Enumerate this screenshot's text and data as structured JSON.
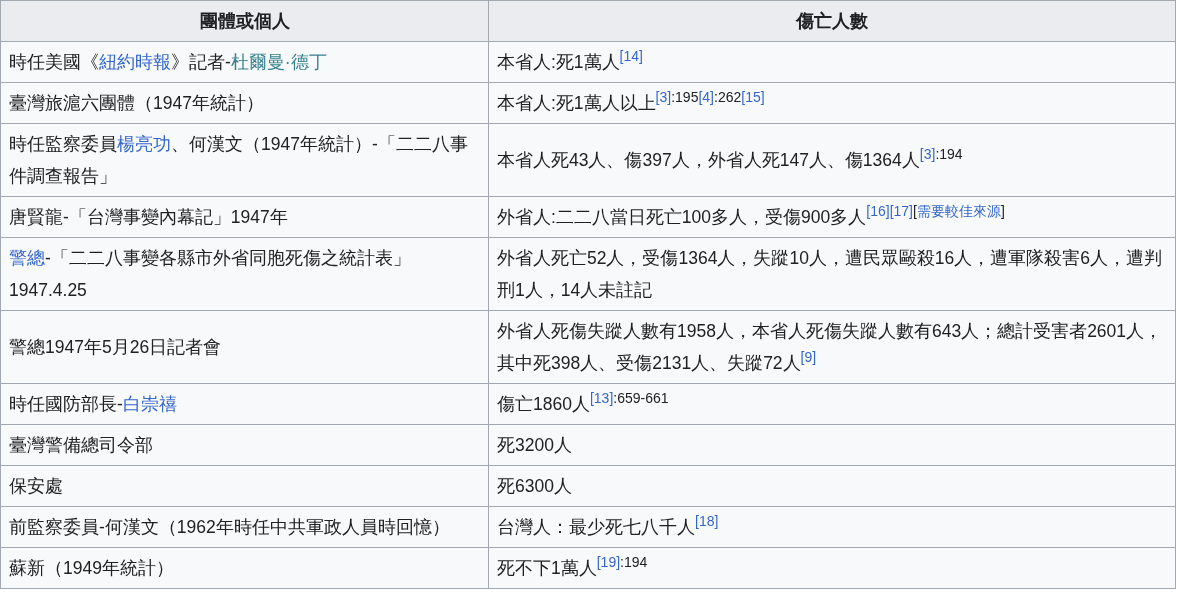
{
  "table": {
    "columns": [
      "團體或個人",
      "傷亡人數"
    ],
    "rows": [
      [
        [
          {
            "kind": "text",
            "text": "時任美國《"
          },
          {
            "kind": "link",
            "text": "紐約時報"
          },
          {
            "kind": "text",
            "text": "》記者-"
          },
          {
            "kind": "ext-link",
            "text": "杜爾曼·德丁"
          }
        ],
        [
          {
            "kind": "text",
            "text": "本省人:死1萬人"
          },
          {
            "kind": "ref",
            "text": "[14]"
          }
        ]
      ],
      [
        [
          {
            "kind": "text",
            "text": "臺灣旅滬六團體（1947年統計）"
          }
        ],
        [
          {
            "kind": "text",
            "text": "本省人:死1萬人以上"
          },
          {
            "kind": "ref",
            "text": "[3]"
          },
          {
            "kind": "sup",
            "text": ":195"
          },
          {
            "kind": "ref",
            "text": "[4]"
          },
          {
            "kind": "sup",
            "text": ":262"
          },
          {
            "kind": "ref",
            "text": "[15]"
          }
        ]
      ],
      [
        [
          {
            "kind": "text",
            "text": "時任監察委員"
          },
          {
            "kind": "link",
            "text": "楊亮功"
          },
          {
            "kind": "text",
            "text": "、何漢文（1947年統計）-「二二八事件調查報告」"
          }
        ],
        [
          {
            "kind": "text",
            "text": "本省人死43人、傷397人，外省人死147人、傷1364人"
          },
          {
            "kind": "ref",
            "text": "[3]"
          },
          {
            "kind": "sup",
            "text": ":194"
          }
        ]
      ],
      [
        [
          {
            "kind": "text",
            "text": "唐賢龍-「台灣事變內幕記」1947年"
          }
        ],
        [
          {
            "kind": "text",
            "text": "外省人:二二八當日死亡100多人，受傷900多人"
          },
          {
            "kind": "ref",
            "text": "[16]"
          },
          {
            "kind": "ref",
            "text": "[17]"
          },
          {
            "kind": "sup",
            "text": "["
          },
          {
            "kind": "ref",
            "text": "需要較佳來源"
          },
          {
            "kind": "sup",
            "text": "]"
          }
        ]
      ],
      [
        [
          {
            "kind": "link",
            "text": "警總"
          },
          {
            "kind": "text",
            "text": "-「二二八事變各縣市外省同胞死傷之統計表」1947.4.25"
          }
        ],
        [
          {
            "kind": "text",
            "text": "外省人死亡52人，受傷1364人，失蹤10人，遭民眾毆殺16人，遭軍隊殺害6人，遭判刑1人，14人未註記"
          }
        ]
      ],
      [
        [
          {
            "kind": "text",
            "text": "警總1947年5月26日記者會"
          }
        ],
        [
          {
            "kind": "text",
            "text": "外省人死傷失蹤人數有1958人，本省人死傷失蹤人數有643人；總計受害者2601人，其中死398人、受傷2131人、失蹤72人"
          },
          {
            "kind": "ref",
            "text": "[9]"
          }
        ]
      ],
      [
        [
          {
            "kind": "text",
            "text": "時任國防部長-"
          },
          {
            "kind": "link",
            "text": "白崇禧"
          }
        ],
        [
          {
            "kind": "text",
            "text": "傷亡1860人"
          },
          {
            "kind": "ref",
            "text": "[13]"
          },
          {
            "kind": "sup",
            "text": ":659-661"
          }
        ]
      ],
      [
        [
          {
            "kind": "text",
            "text": "臺灣警備總司令部"
          }
        ],
        [
          {
            "kind": "text",
            "text": "死3200人"
          }
        ]
      ],
      [
        [
          {
            "kind": "text",
            "text": "保安處"
          }
        ],
        [
          {
            "kind": "text",
            "text": "死6300人"
          }
        ]
      ],
      [
        [
          {
            "kind": "text",
            "text": "前監察委員-何漢文（1962年時任中共軍政人員時回憶）"
          }
        ],
        [
          {
            "kind": "text",
            "text": "台灣人：最少死七八千人"
          },
          {
            "kind": "ref",
            "text": "[18]"
          }
        ]
      ],
      [
        [
          {
            "kind": "text",
            "text": "蘇新（1949年統計）"
          }
        ],
        [
          {
            "kind": "text",
            "text": "死不下1萬人"
          },
          {
            "kind": "ref",
            "text": "[19]"
          },
          {
            "kind": "sup",
            "text": ":194"
          }
        ]
      ]
    ]
  }
}
